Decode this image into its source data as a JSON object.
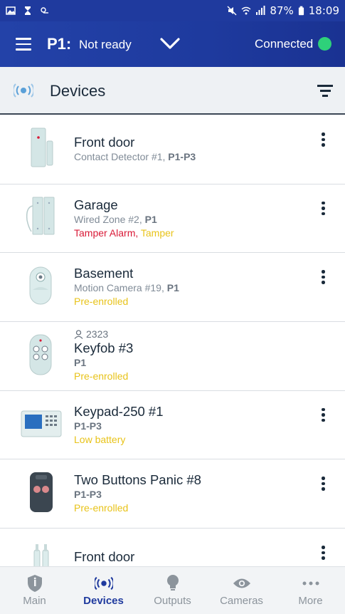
{
  "status_bar": {
    "battery": "87%",
    "time": "18:09"
  },
  "app_bar": {
    "partition": "P1:",
    "state": "Not ready",
    "connection_label": "Connected",
    "connection_color": "#2ed17a"
  },
  "section": {
    "title": "Devices"
  },
  "devices": [
    {
      "name": "Front door",
      "sub_prefix": "Contact Detector #1, ",
      "sub_bold": "P1-P3",
      "status": "",
      "status2": "",
      "icon": "contact-detector-icon"
    },
    {
      "name": "Garage",
      "sub_prefix": "Wired Zone #2, ",
      "sub_bold": "P1",
      "status": "Tamper Alarm",
      "status2": "Tamper",
      "icon": "wired-zone-icon"
    },
    {
      "name": "Basement",
      "sub_prefix": "Motion Camera #19, ",
      "sub_bold": "P1",
      "status": "Pre-enrolled",
      "status2": "",
      "icon": "motion-camera-icon"
    },
    {
      "name": "Keyfob #3",
      "badge": "2323",
      "sub_prefix": "",
      "sub_bold": "P1",
      "status": "Pre-enrolled",
      "status2": "",
      "icon": "keyfob-icon"
    },
    {
      "name": "Keypad-250 #1",
      "sub_prefix": "",
      "sub_bold": "P1-P3",
      "status": "Low battery",
      "status2": "",
      "icon": "keypad-icon"
    },
    {
      "name": "Two Buttons Panic #8",
      "sub_prefix": "",
      "sub_bold": "P1-P3",
      "status": "Pre-enrolled",
      "status2": "",
      "icon": "panic-button-icon"
    },
    {
      "name": "Front door",
      "sub_prefix": "",
      "sub_bold": "",
      "status": "",
      "status2": "",
      "icon": "smoke-detector-icon"
    }
  ],
  "bottom_nav": {
    "main": "Main",
    "devices": "Devices",
    "outputs": "Outputs",
    "cameras": "Cameras",
    "more": "More"
  },
  "colors": {
    "primary": "#1f3a9e",
    "alarm": "#d91a37",
    "warning": "#e8c31a"
  }
}
